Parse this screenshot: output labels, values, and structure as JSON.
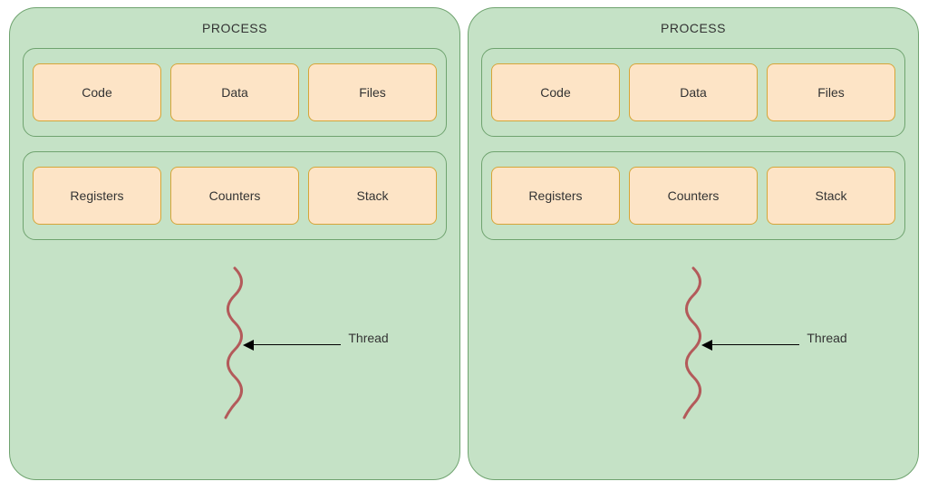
{
  "processes": [
    {
      "title": "PROCESS",
      "group1": [
        {
          "label": "Code"
        },
        {
          "label": "Data"
        },
        {
          "label": "Files"
        }
      ],
      "group2": [
        {
          "label": "Registers"
        },
        {
          "label": "Counters"
        },
        {
          "label": "Stack"
        }
      ],
      "thread_label": "Thread"
    },
    {
      "title": "PROCESS",
      "group1": [
        {
          "label": "Code"
        },
        {
          "label": "Data"
        },
        {
          "label": "Files"
        }
      ],
      "group2": [
        {
          "label": "Registers"
        },
        {
          "label": "Counters"
        },
        {
          "label": "Stack"
        }
      ],
      "thread_label": "Thread"
    }
  ],
  "colors": {
    "process_bg": "#c5e2c6",
    "process_border": "#6fa36f",
    "box_bg": "#fde4c6",
    "box_border": "#d6a538",
    "squiggle": "#b35a5a"
  }
}
